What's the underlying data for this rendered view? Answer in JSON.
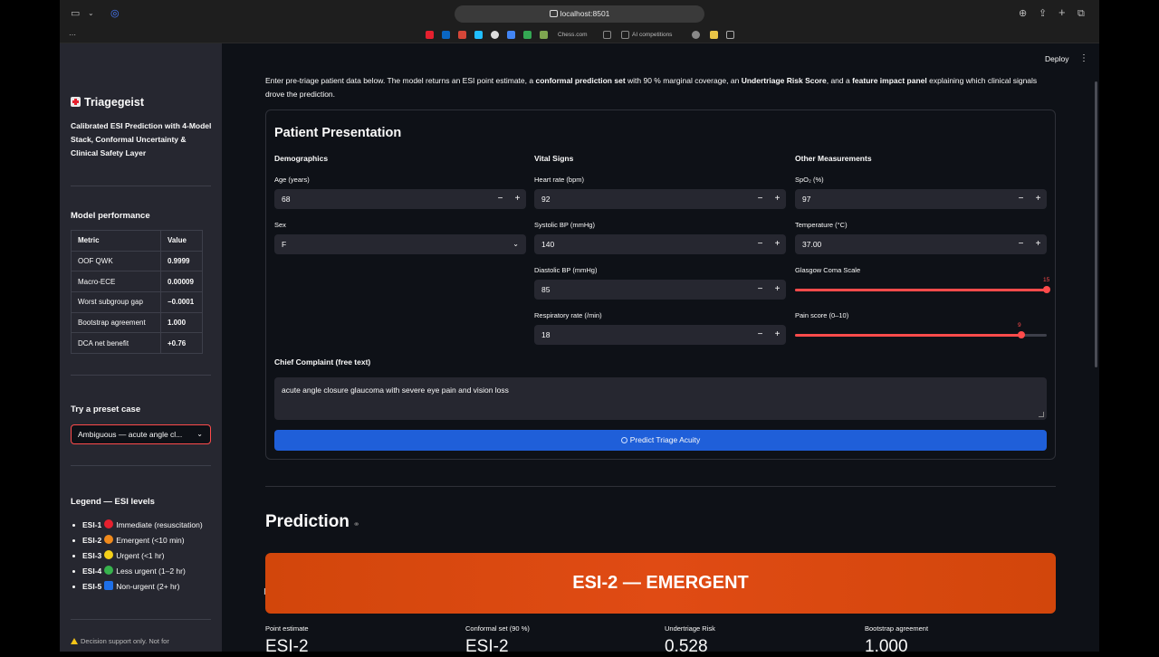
{
  "browser": {
    "url": "localhost:8501",
    "bookmarks": [
      "Chess.com",
      "AI competitions"
    ]
  },
  "app": {
    "title": "Triagegeist",
    "subtitle": "Calibrated ESI Prediction with 4-Model Stack, Conformal Uncertainty & Clinical Safety Layer",
    "deploy": "Deploy"
  },
  "sidebar": {
    "performance_heading": "Model performance",
    "table": {
      "headers": [
        "Metric",
        "Value"
      ],
      "rows": [
        [
          "OOF QWK",
          "0.9999"
        ],
        [
          "Macro-ECE",
          "0.00009"
        ],
        [
          "Worst subgroup gap",
          "−0.0001"
        ],
        [
          "Bootstrap agreement",
          "1.000"
        ],
        [
          "DCA net benefit",
          "+0.76"
        ]
      ]
    },
    "preset_heading": "Try a preset case",
    "preset_value": "Ambiguous — acute angle cl...",
    "legend_heading": "Legend — ESI levels",
    "legend": [
      {
        "code": "ESI-1",
        "desc": "Immediate (resuscitation)",
        "color": "#e5202e"
      },
      {
        "code": "ESI-2",
        "desc": "Emergent (<10 min)",
        "color": "#f08a1c"
      },
      {
        "code": "ESI-3",
        "desc": "Urgent (<1 hr)",
        "color": "#f5d019"
      },
      {
        "code": "ESI-4",
        "desc": "Less urgent (1–2 hr)",
        "color": "#37b24d"
      },
      {
        "code": "ESI-5",
        "desc": "Non-urgent (2+ hr)",
        "color": "#1e6fe8"
      }
    ],
    "disclaimer": "Decision support only. Not for"
  },
  "intro": {
    "p1": "Enter pre-triage patient data below. The model returns an ESI point estimate, a ",
    "b1": "conformal prediction set",
    "p2": " with 90 % marginal coverage, an ",
    "b2": "Undertriage Risk Score",
    "p3": ", and a ",
    "b3": "feature impact panel",
    "p4": " explaining which clinical signals drove the prediction."
  },
  "form": {
    "title": "Patient Presentation",
    "demographics": "Demographics",
    "vitals": "Vital Signs",
    "other": "Other Measurements",
    "age_label": "Age (years)",
    "age": "68",
    "sex_label": "Sex",
    "sex": "F",
    "hr_label": "Heart rate (bpm)",
    "hr": "92",
    "sbp_label": "Systolic BP (mmHg)",
    "sbp": "140",
    "dbp_label": "Diastolic BP (mmHg)",
    "dbp": "85",
    "rr_label": "Respiratory rate (/min)",
    "rr": "18",
    "spo2_label": "SpO₂ (%)",
    "spo2": "97",
    "temp_label": "Temperature (°C)",
    "temp": "37.00",
    "gcs_label": "Glasgow Coma Scale",
    "gcs": "15",
    "pain_label": "Pain score (0–10)",
    "pain": "9",
    "complaint_label": "Chief Complaint (free text)",
    "complaint": "acute angle closure glaucoma with severe eye pain and vision loss",
    "predict_button": "Predict Triage Acuity",
    "minus": "−",
    "plus": "+"
  },
  "sliders": {
    "gcs": {
      "min": 3,
      "max": 15,
      "value": 15
    },
    "pain": {
      "min": 0,
      "max": 10,
      "value": 9
    }
  },
  "prediction": {
    "heading": "Prediction",
    "banner": "ESI-2 — EMERGENT",
    "banner_color": "#d84a10",
    "stats": [
      {
        "label": "Point estimate",
        "value": "ESI-2"
      },
      {
        "label": "Conformal set (90 %)",
        "value": "ESI-2"
      },
      {
        "label": "Undertriage Risk",
        "value": "0.528"
      },
      {
        "label": "Bootstrap agreement",
        "value": "1.000"
      }
    ]
  }
}
